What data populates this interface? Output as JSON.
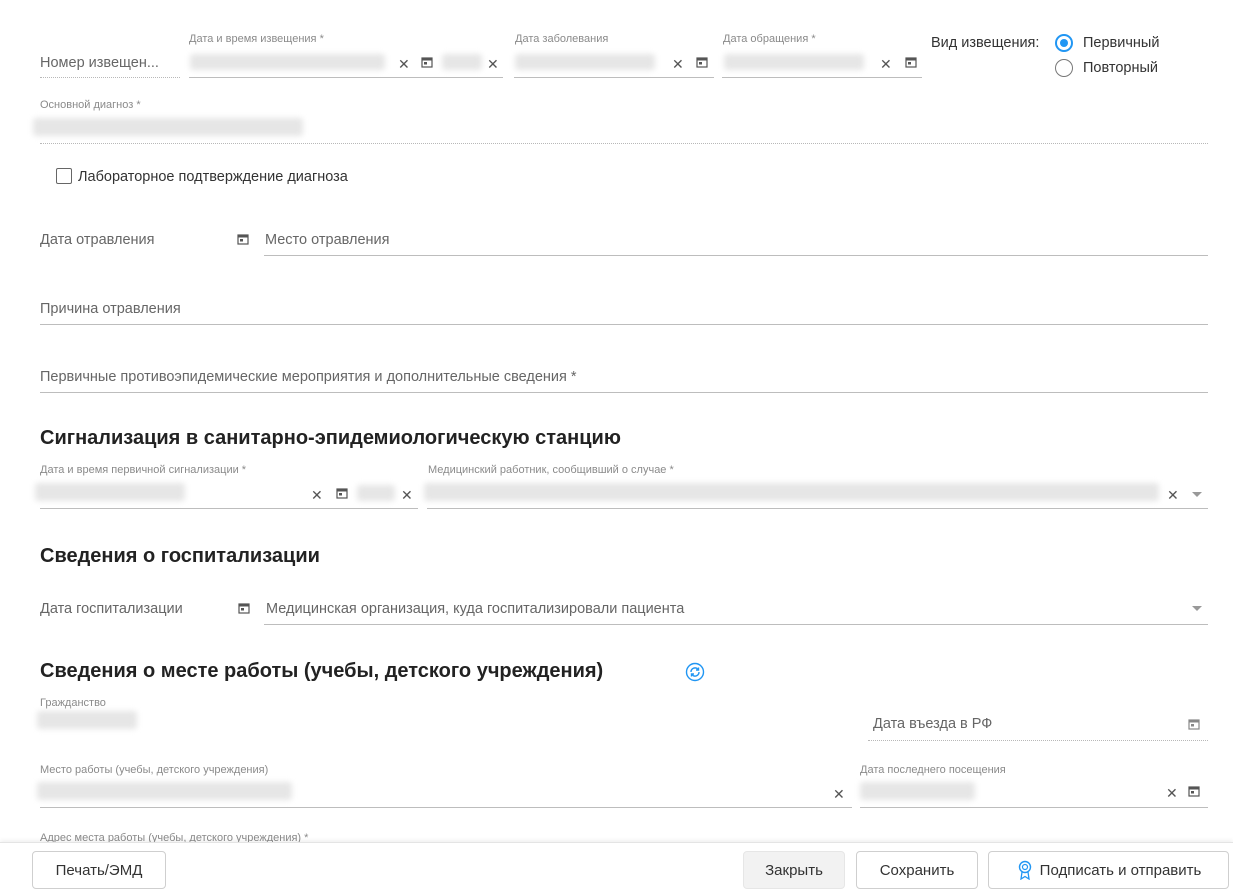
{
  "notice": {
    "number_label": "Номер извещен...",
    "datetime_label": "Дата и время извещения *",
    "disease_date_label": "Дата заболевания",
    "appeal_date_label": "Дата обращения *",
    "kind_label": "Вид извещения:",
    "kind_options": [
      "Первичный",
      "Повторный"
    ],
    "kind_selected": "Первичный"
  },
  "diagnosis": {
    "label": "Основной диагноз *",
    "lab_confirm_label": "Лабораторное подтверждение диагноза",
    "lab_confirm_checked": false
  },
  "poisoning": {
    "date_placeholder": "Дата отравления",
    "place_placeholder": "Место отравления",
    "cause_placeholder": "Причина отравления",
    "measures_placeholder": "Первичные противоэпидемические мероприятия и дополнительные сведения *"
  },
  "signal": {
    "heading": "Сигнализация в санитарно-эпидемиологическую станцию",
    "datetime_label": "Дата и время первичной сигнализации *",
    "worker_label": "Медицинский работник, сообщивший о случае *"
  },
  "hospital": {
    "heading": "Сведения о госпитализации",
    "date_placeholder": "Дата госпитализации",
    "org_placeholder": "Медицинская организация, куда госпитализировали пациента"
  },
  "work": {
    "heading": "Сведения о месте работы (учебы, детского учреждения)",
    "citizenship_label": "Гражданство",
    "entry_date_placeholder": "Дата въезда в РФ",
    "workplace_label": "Место работы (учебы, детского учреждения)",
    "last_visit_label": "Дата последнего посещения",
    "address_label": "Адрес места работы (учебы, детского учреждения) *"
  },
  "footer": {
    "print_label": "Печать/ЭМД",
    "close_label": "Закрыть",
    "save_label": "Сохранить",
    "sign_send_label": "Подписать и отправить"
  },
  "colors": {
    "accent": "#2196f3",
    "underline": "#bdbdbd"
  }
}
